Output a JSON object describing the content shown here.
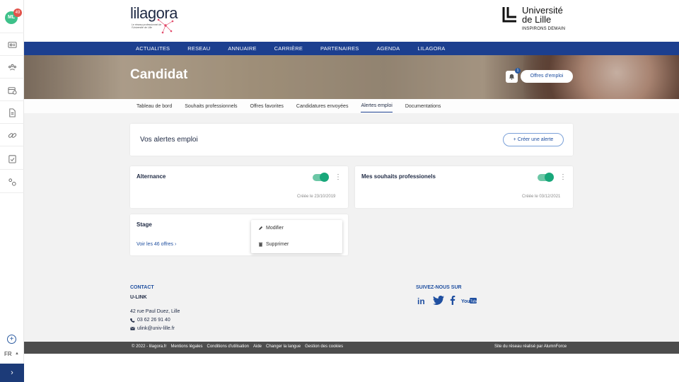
{
  "rail": {
    "avatar_initials": "ML",
    "notifications": "49",
    "lang": "FR",
    "expand_icon": "›"
  },
  "brand": {
    "name": "lilagora",
    "tagline": "Le réseau professionnel de l'Université de Lille"
  },
  "university": {
    "name_line1": "Université",
    "name_line2": "de Lille",
    "tagline": "INSPIRONS DEMAIN"
  },
  "nav": [
    "ACTUALITES",
    "RESEAU",
    "ANNUAIRE",
    "CARRIÈRE",
    "PARTENAIRES",
    "AGENDA",
    "LILAGORA"
  ],
  "hero": {
    "title": "Candidat",
    "bell_badge": "1",
    "offres_button": "Offres d'emploi"
  },
  "subtabs": [
    {
      "label": "Tableau de bord",
      "active": false
    },
    {
      "label": "Souhaits professionnels",
      "active": false
    },
    {
      "label": "Offres favorites",
      "active": false
    },
    {
      "label": "Candidatures envoyées",
      "active": false
    },
    {
      "label": "Alertes emploi",
      "active": true
    },
    {
      "label": "Documentations",
      "active": false
    }
  ],
  "alerts_header": {
    "title": "Vos alertes emploi",
    "create_button": "+ Créer une alerte"
  },
  "alerts": [
    {
      "title": "Alternance",
      "enabled": true,
      "created": "Créée le 23/10/2019"
    },
    {
      "title": "Mes souhaits professionels",
      "enabled": true,
      "created": "Créée le 03/12/2021"
    },
    {
      "title": "Stage",
      "link": "Voir les 46 offres ›"
    }
  ],
  "context_menu": {
    "edit": "Modifier",
    "delete": "Supprimer"
  },
  "footer": {
    "contact_heading": "CONTACT",
    "org": "U-LINK",
    "address": "42 rue Paul Duez, Lille",
    "phone": "03 62 26 91 40",
    "email": "ulink@univ-lille.fr",
    "social_heading": "SUIVEZ-NOUS SUR",
    "social_icons": [
      "linkedin-icon",
      "twitter-icon",
      "facebook-icon",
      "youtube-icon"
    ],
    "youtube_label": "You Tube"
  },
  "bottom_links": [
    "© 2022 - lilagora.fr",
    "Mentions légales",
    "Conditions d'utilisation",
    "Aide",
    "Changer la langue",
    "Gestion des cookies"
  ],
  "bottom_right": "Site du réseau réalisé par AlumnForce",
  "colors": {
    "nav_blue": "#1c3f8f",
    "toggle_green": "#18a77a",
    "footer_bar": "#4d4d4d"
  }
}
